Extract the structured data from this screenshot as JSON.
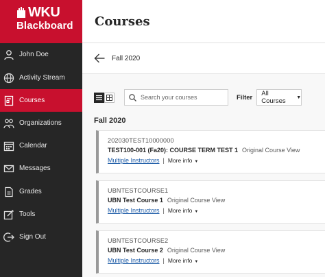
{
  "brand": {
    "line1": "WKU",
    "line2": "Blackboard"
  },
  "sidebar": {
    "items": [
      {
        "label": "John Doe",
        "icon": "user-icon"
      },
      {
        "label": "Activity Stream",
        "icon": "globe-icon"
      },
      {
        "label": "Courses",
        "icon": "courses-icon",
        "active": true
      },
      {
        "label": "Organizations",
        "icon": "organizations-icon"
      },
      {
        "label": "Calendar",
        "icon": "calendar-icon"
      },
      {
        "label": "Messages",
        "icon": "envelope-icon"
      },
      {
        "label": "Grades",
        "icon": "grades-icon"
      },
      {
        "label": "Tools",
        "icon": "tools-icon"
      },
      {
        "label": "Sign Out",
        "icon": "sign-out-icon"
      }
    ]
  },
  "header": {
    "title": "Courses"
  },
  "term": {
    "label": "Fall 2020"
  },
  "toolbar": {
    "search_placeholder": "Search your courses",
    "filter_label": "Filter",
    "filter_value": "All Courses"
  },
  "section": {
    "heading": "Fall 2020"
  },
  "courses": [
    {
      "id": "202030TEST10000000",
      "name": "TEST100-001 (Fa20): COURSE TERM TEST 1",
      "view": "Original Course View",
      "instructors": "Multiple Instructors",
      "more": "More info"
    },
    {
      "id": "UBNTESTCOURSE1",
      "name": "UBN Test Course 1",
      "view": "Original Course View",
      "instructors": "Multiple Instructors",
      "more": "More info"
    },
    {
      "id": "UBNTESTCOURSE2",
      "name": "UBN Test Course 2",
      "view": "Original Course View",
      "instructors": "Multiple Instructors",
      "more": "More info"
    }
  ],
  "colors": {
    "brand_red": "#c8102e",
    "sidebar_bg": "#262626",
    "link_blue": "#1f5da8"
  }
}
